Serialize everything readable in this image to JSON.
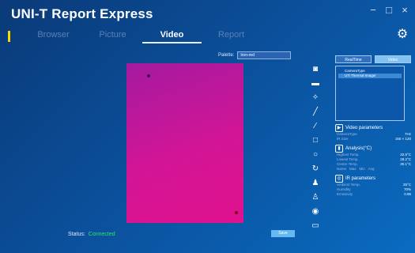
{
  "app": {
    "title": "UNI-T Report Express"
  },
  "window_controls": {
    "minimize": "−",
    "maximize": "□",
    "close": "×"
  },
  "tabs": [
    {
      "label": "Browser",
      "active": false
    },
    {
      "label": "Picture",
      "active": false
    },
    {
      "label": "Video",
      "active": true
    },
    {
      "label": "Report",
      "active": false
    }
  ],
  "palette": {
    "label": "Palette:",
    "value": "Iron-red"
  },
  "status": {
    "label": "Status:",
    "value": "Connected"
  },
  "buttons": {
    "save": "Save"
  },
  "right_panel": {
    "tabs": {
      "realtime": "RealTime",
      "video": "Video"
    },
    "list": {
      "header": "CameraType",
      "item": "UTi Thermal Imager"
    },
    "video_params": {
      "title": "Video parameters",
      "rows": [
        {
          "key": "CameraType",
          "value": "7Hz"
        },
        {
          "key": "IR Size",
          "value": "160 × 120"
        }
      ]
    },
    "analysis": {
      "title": "Analysis(°C)",
      "rows": [
        {
          "key": "Highest Temp.",
          "value": "32.5°C"
        },
        {
          "key": "Lowest Temp.",
          "value": "28.2°C"
        },
        {
          "key": "Center Temp.",
          "value": "30.1°C"
        }
      ],
      "chips": [
        "Name",
        "Max",
        "Min",
        "Avg"
      ]
    },
    "ir_params": {
      "title": "IR parameters",
      "rows": [
        {
          "key": "Ambient Temp.",
          "value": "25°C"
        },
        {
          "key": "Humidity",
          "value": "70%"
        },
        {
          "key": "Emissivity",
          "value": "0.95"
        }
      ]
    }
  },
  "colors": {
    "accent_yellow": "#ffd600",
    "status_green": "#2ee36a",
    "thermal_magenta": "#d21596"
  }
}
